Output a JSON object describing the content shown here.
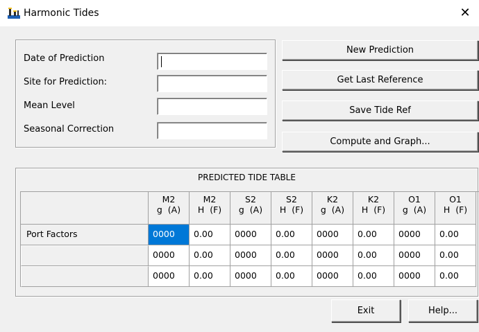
{
  "window": {
    "title": "Harmonic Tides"
  },
  "form": {
    "labels": [
      "Date of Prediction",
      "Site for Prediction:",
      "Mean Level",
      "Seasonal Correction"
    ],
    "values": [
      "",
      "",
      "",
      ""
    ]
  },
  "buttons": {
    "new_prediction": "New Prediction",
    "get_last_reference": "Get Last Reference",
    "save_tide_ref": "Save Tide Ref",
    "compute_and_graph": "Compute and Graph...",
    "exit": "Exit",
    "help": "Help..."
  },
  "table": {
    "title": "PREDICTED TIDE TABLE",
    "columns": [
      {
        "line1": "M2",
        "line2": "g  (A)"
      },
      {
        "line1": "M2",
        "line2": "H  (F)"
      },
      {
        "line1": "S2",
        "line2": "g  (A)"
      },
      {
        "line1": "S2",
        "line2": "H  (F)"
      },
      {
        "line1": "K2",
        "line2": "g  (A)"
      },
      {
        "line1": "K2",
        "line2": "H  (F)"
      },
      {
        "line1": "O1",
        "line2": "g  (A)"
      },
      {
        "line1": "O1",
        "line2": "H  (F)"
      }
    ],
    "rows": [
      {
        "label": "Port Factors",
        "cells": [
          "0000",
          "0.00",
          "0000",
          "0.00",
          "0000",
          "0.00",
          "0000",
          "0.00"
        ]
      },
      {
        "label": "",
        "cells": [
          "0000",
          "0.00",
          "0000",
          "0.00",
          "0000",
          "0.00",
          "0000",
          "0.00"
        ]
      },
      {
        "label": "",
        "cells": [
          "0000",
          "0.00",
          "0000",
          "0.00",
          "0000",
          "0.00",
          "0000",
          "0.00"
        ]
      }
    ]
  }
}
